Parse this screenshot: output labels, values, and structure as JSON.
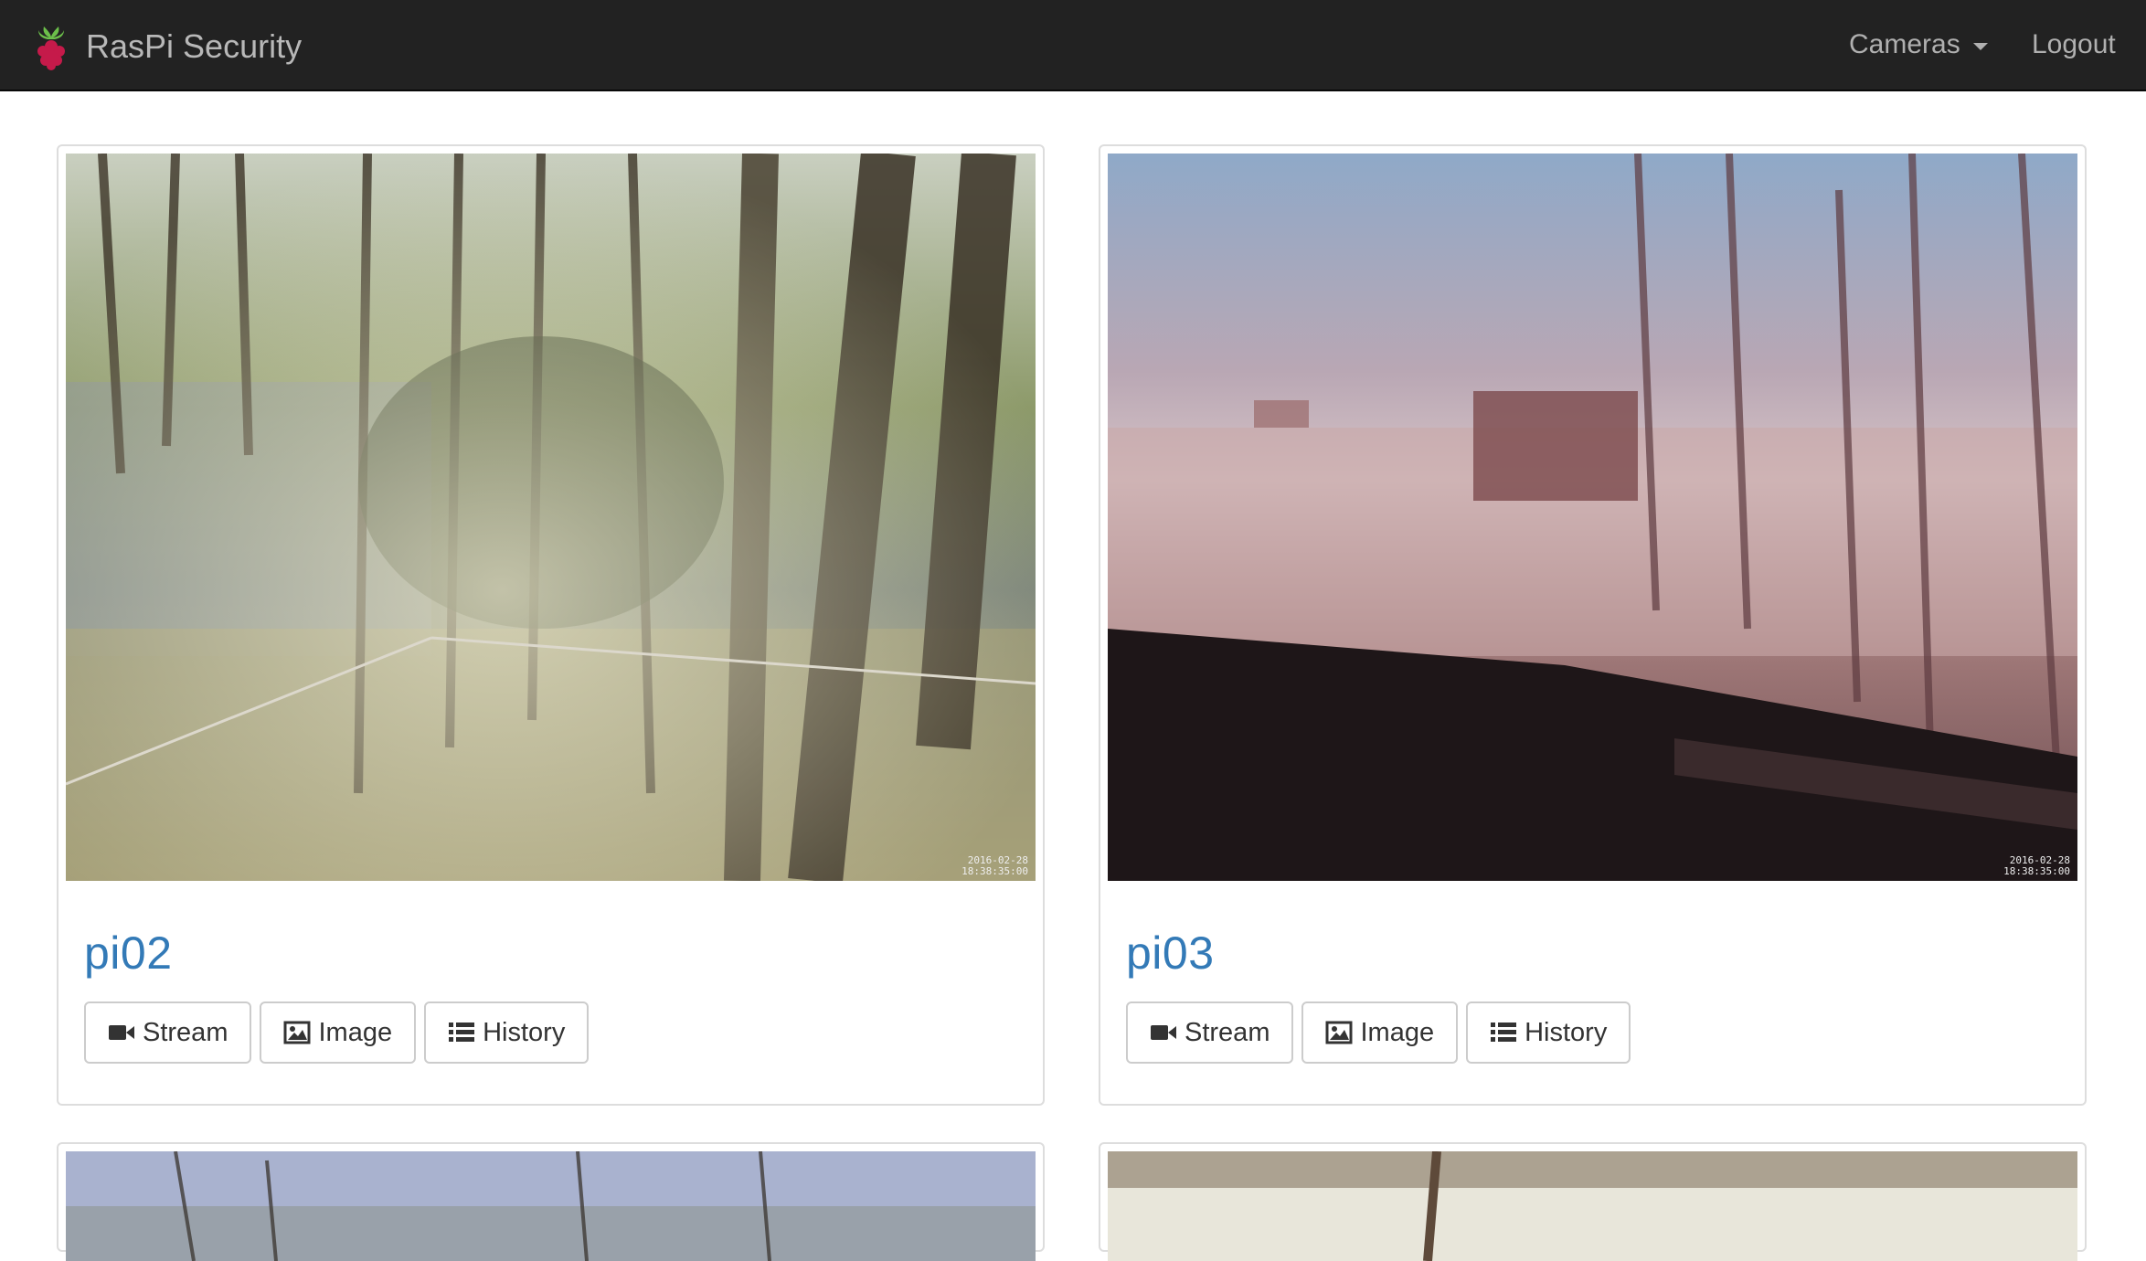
{
  "navbar": {
    "brand": "RasPi Security",
    "cameras_label": "Cameras",
    "logout_label": "Logout"
  },
  "cameras": [
    {
      "name": "pi02",
      "stamp": "2016-02-28\n18:38:35:00",
      "buttons": {
        "stream": "Stream",
        "image": "Image",
        "history": "History"
      }
    },
    {
      "name": "pi03",
      "stamp": "2016-02-28\n18:38:35:00",
      "buttons": {
        "stream": "Stream",
        "image": "Image",
        "history": "History"
      }
    }
  ],
  "colors": {
    "navbar": "#222222",
    "link": "#337ab7",
    "nav_text": "#9d9d9d"
  },
  "icons": {
    "brand": "raspberry-icon",
    "stream": "video-camera-icon",
    "image": "picture-icon",
    "history": "list-icon",
    "dropdown": "caret-down-icon"
  }
}
